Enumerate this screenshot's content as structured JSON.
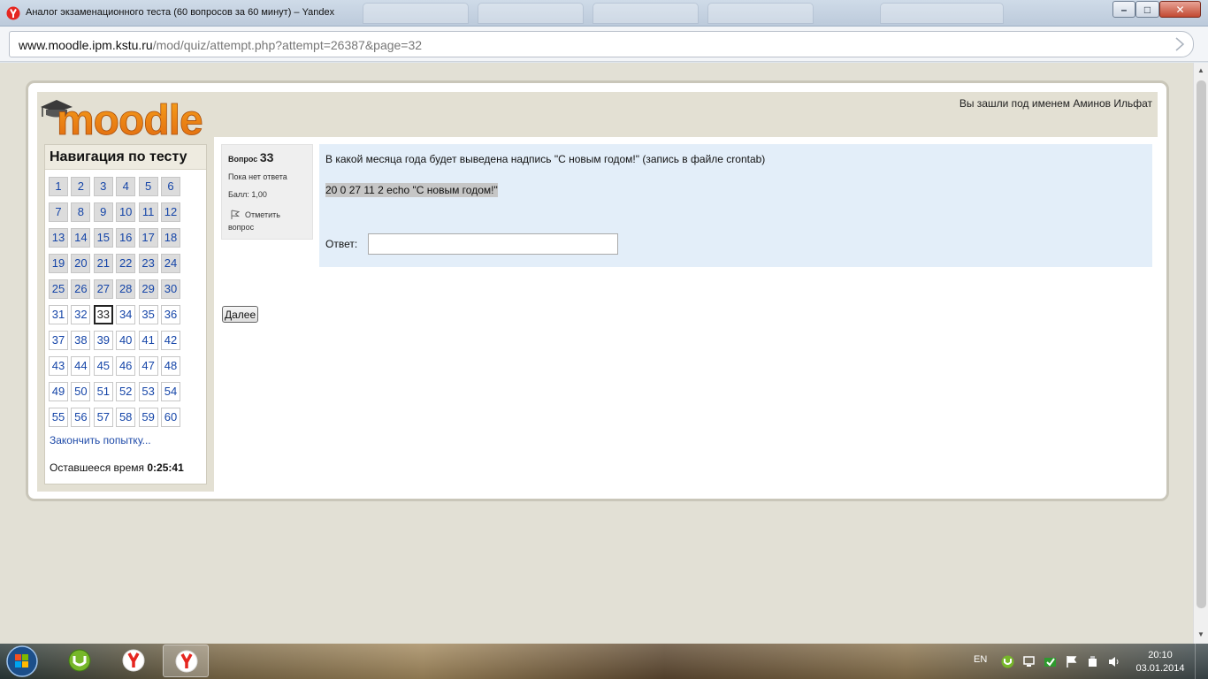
{
  "window": {
    "title": "Аналог экзаменационного теста (60 вопросов за 60 минут) – Yandex",
    "minimize_glyph": "–",
    "maximize_glyph": "□",
    "close_glyph": "✕"
  },
  "address": {
    "host": "www.moodle.ipm.kstu.ru",
    "path": "/mod/quiz/attempt.php?attempt=26387&page=32"
  },
  "header": {
    "logo_text": "moodle",
    "user_info": "Вы зашли под именем Аминов Ильфат"
  },
  "quiz_nav": {
    "title": "Навигация по тесту",
    "answered_through": 30,
    "current": 33,
    "questions": [
      "1",
      "2",
      "3",
      "4",
      "5",
      "6",
      "7",
      "8",
      "9",
      "10",
      "11",
      "12",
      "13",
      "14",
      "15",
      "16",
      "17",
      "18",
      "19",
      "20",
      "21",
      "22",
      "23",
      "24",
      "25",
      "26",
      "27",
      "28",
      "29",
      "30",
      "31",
      "32",
      "33",
      "34",
      "35",
      "36",
      "37",
      "38",
      "39",
      "40",
      "41",
      "42",
      "43",
      "44",
      "45",
      "46",
      "47",
      "48",
      "49",
      "50",
      "51",
      "52",
      "53",
      "54",
      "55",
      "56",
      "57",
      "58",
      "59",
      "60"
    ],
    "finish_link": "Закончить попытку...",
    "time_label": "Оставшееся время",
    "time_value": "0:25:41"
  },
  "question": {
    "label": "Вопрос",
    "number": "33",
    "state": "Пока нет ответа",
    "grade": "Балл: 1,00",
    "flag": "Отметить вопрос",
    "text": "В какой месяца года будет выведена надпись \"С новым годом!\" (запись в файле crontab)",
    "code": "20 0 27 11 2 echo \"С новым годом!\"",
    "answer_label": "Ответ:",
    "answer_value": ""
  },
  "next_button": "Далее",
  "taskbar": {
    "language": "EN",
    "time": "20:10",
    "date": "03.01.2014"
  },
  "colors": {
    "accent_link": "#1545a8",
    "question_bg": "#e3eef9",
    "block_bg": "#e3e0d3"
  }
}
